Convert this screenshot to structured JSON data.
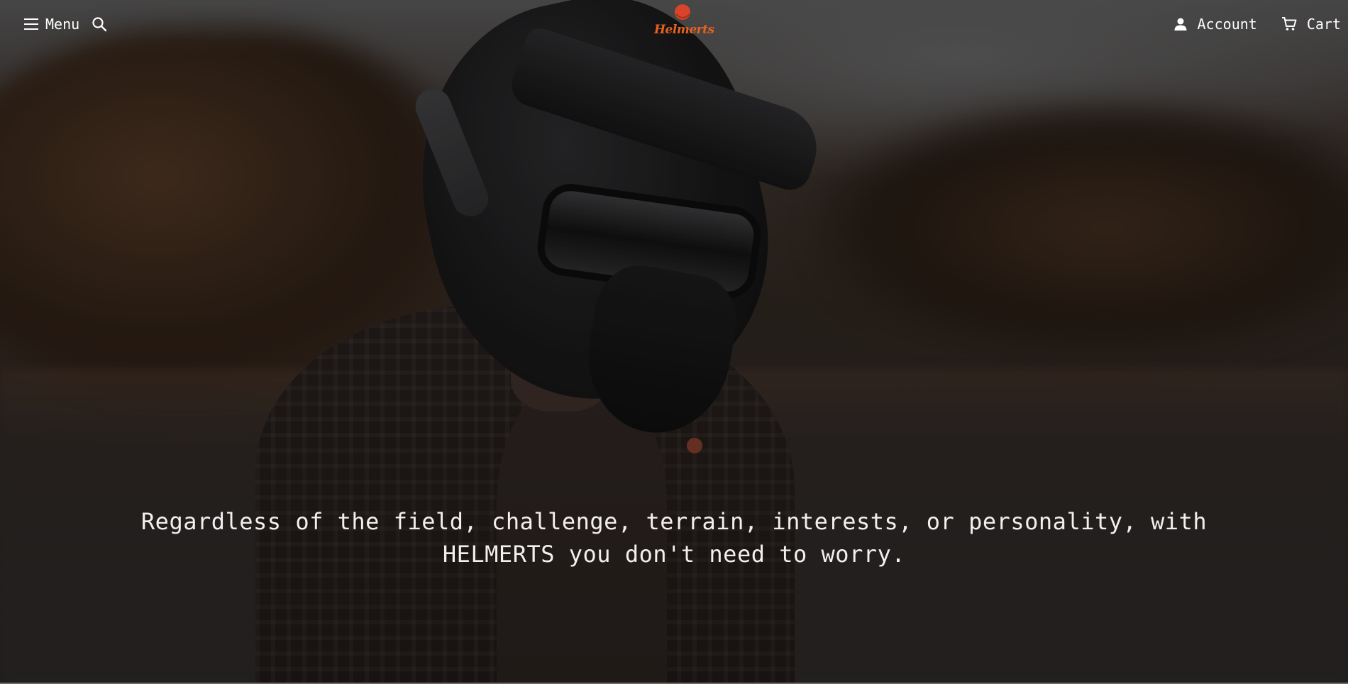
{
  "header": {
    "menu_label": "Menu",
    "logo_text": "Helmerts",
    "account_label": "Account",
    "cart_label": "Cart"
  },
  "hero": {
    "tagline": "Regardless of the field, challenge, terrain, interests, or personality, with HELMERTS you don't need to worry."
  },
  "colors": {
    "brand": "#e8621f",
    "logo_mark": "#d8432b",
    "text": "#ffffff"
  },
  "icons": [
    "hamburger-icon",
    "search-icon",
    "account-icon",
    "cart-icon"
  ]
}
